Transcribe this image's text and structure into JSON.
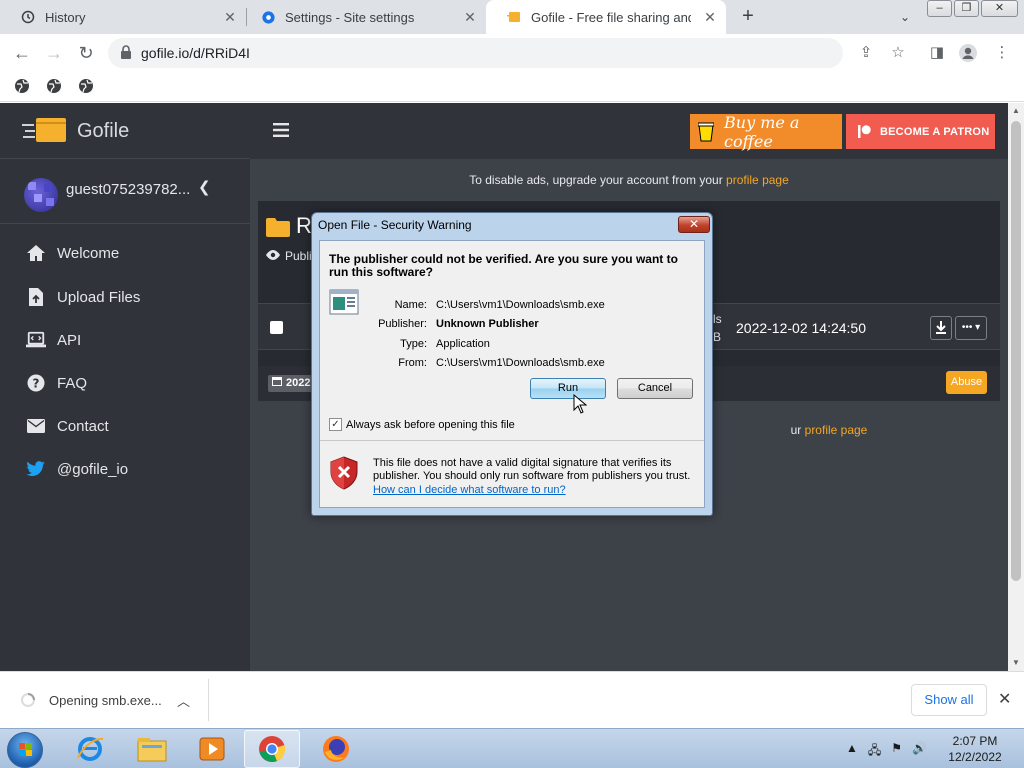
{
  "browser": {
    "tabs": [
      {
        "label": "History",
        "icon": "history-icon"
      },
      {
        "label": "Settings - Site settings",
        "icon": "gear-icon"
      },
      {
        "label": "Gofile - Free file sharing and stor",
        "icon": "gofile-favicon"
      }
    ],
    "url": "gofile.io/d/RRiD4I"
  },
  "sidebar": {
    "logo_text": "Gofile",
    "username": "guest075239782...",
    "nav": [
      {
        "label": "Welcome",
        "icon": "home-icon"
      },
      {
        "label": "Upload Files",
        "icon": "upload-file-icon"
      },
      {
        "label": "API",
        "icon": "laptop-code-icon"
      },
      {
        "label": "FAQ",
        "icon": "question-circle-icon"
      },
      {
        "label": "Contact",
        "icon": "envelope-icon"
      },
      {
        "label": "@gofile_io",
        "icon": "twitter-icon"
      }
    ]
  },
  "header": {
    "coffee_label": "Buy me a coffee",
    "patron_label": "BECOME A PATRON"
  },
  "content": {
    "ads_text": "To disable ads, upgrade your account from your",
    "ads_link": "profile page",
    "folder_initial": "R",
    "public_label": "Publi",
    "size_line1": "ls",
    "size_line2": "B",
    "file_date": "2022-12-02 14:24:50",
    "date_badge": "2022",
    "abuse_label": "Abuse",
    "profile_text_tail": "ur",
    "profile_link": "profile page"
  },
  "dialog": {
    "title": "Open File - Security Warning",
    "heading": "The publisher could not be verified.  Are you sure you want to run this software?",
    "fields": [
      {
        "label": "Name:",
        "value": "C:\\Users\\vm1\\Downloads\\smb.exe"
      },
      {
        "label": "Publisher:",
        "value": "Unknown Publisher"
      },
      {
        "label": "Type:",
        "value": "Application"
      },
      {
        "label": "From:",
        "value": "C:\\Users\\vm1\\Downloads\\smb.exe"
      }
    ],
    "run_label": "Run",
    "cancel_label": "Cancel",
    "always_ask_label": "Always ask before opening this file",
    "always_ask_checked": true,
    "warning_text": "This file does not have a valid digital signature that verifies its publisher.  You should only run software from publishers you trust.",
    "warning_link": "How can I decide what software to run?"
  },
  "download_bar": {
    "item_label": "Opening smb.exe...",
    "show_all_label": "Show all"
  },
  "taskbar": {
    "time": "2:07 PM",
    "date": "12/2/2022"
  },
  "colors": {
    "accent": "#f5a623",
    "page_bg": "#3d4148",
    "sidebar_bg": "#30343a",
    "coffee": "#f28b2a",
    "patron": "#f15b50"
  }
}
